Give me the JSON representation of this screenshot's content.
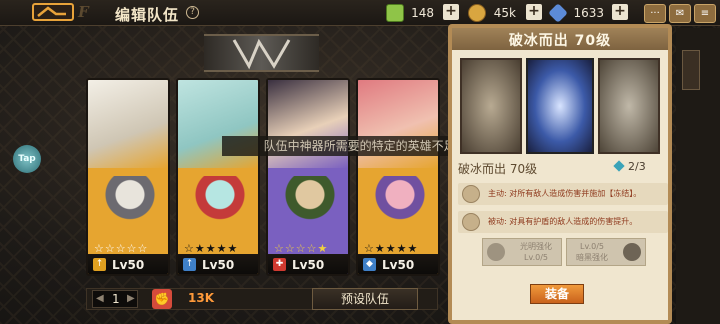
{
  "header": {
    "title": "编辑队伍",
    "help": "?"
  },
  "resources": [
    {
      "name": "green-cube-icon",
      "value": "148",
      "color": "#8fc448"
    },
    {
      "name": "gold-coin-icon",
      "value": "45k",
      "color": "#d9a640"
    },
    {
      "name": "blue-crystal-icon",
      "value": "1633",
      "color": "#5c8bd8"
    }
  ],
  "plus": "+",
  "team": {
    "warning": "队伍中神器所需要的特定的英雄不足!",
    "cards": [
      {
        "level": "Lv50",
        "stars": "☆☆☆☆☆",
        "role": "↑",
        "role_color": "#e0a020",
        "bg": "#e6a530",
        "stars_filled": 5,
        "stars_color": "#ffffff"
      },
      {
        "level": "Lv50",
        "stars": "☆★★★★",
        "role": "↑",
        "role_color": "#3f80c8",
        "bg": "#e6a530",
        "stars_filled": 1,
        "stars_color": "#111111"
      },
      {
        "level": "Lv50",
        "stars": "☆☆☆☆★",
        "role": "✚",
        "role_color": "#d03a30",
        "bg": "#7a60c0",
        "stars_filled": 4,
        "stars_color": "#f0d040"
      },
      {
        "level": "Lv50",
        "stars": "☆★★★★",
        "role": "◆",
        "role_color": "#3f80c8",
        "bg": "#e6a530",
        "stars_filled": 1,
        "stars_color": "#111111"
      }
    ],
    "page": "1",
    "power": "13K",
    "preset_label": "预设队伍"
  },
  "tap_label": "Tap",
  "relic_panel": {
    "title": "破冰而出 70级",
    "name": "破冰而出 70级",
    "count": "2/3",
    "skill_active": "主动: 对所有敌人造成伤害并施加【冻结】。",
    "skill_passive": "被动: 对具有护盾的敌人造成的伤害提升。",
    "enh_light": "光明强化",
    "enh_light_lv": "Lv.0/5",
    "enh_dark_lv": "Lv.0/5",
    "enh_dark": "暗黑强化",
    "equip_label": "装备"
  }
}
